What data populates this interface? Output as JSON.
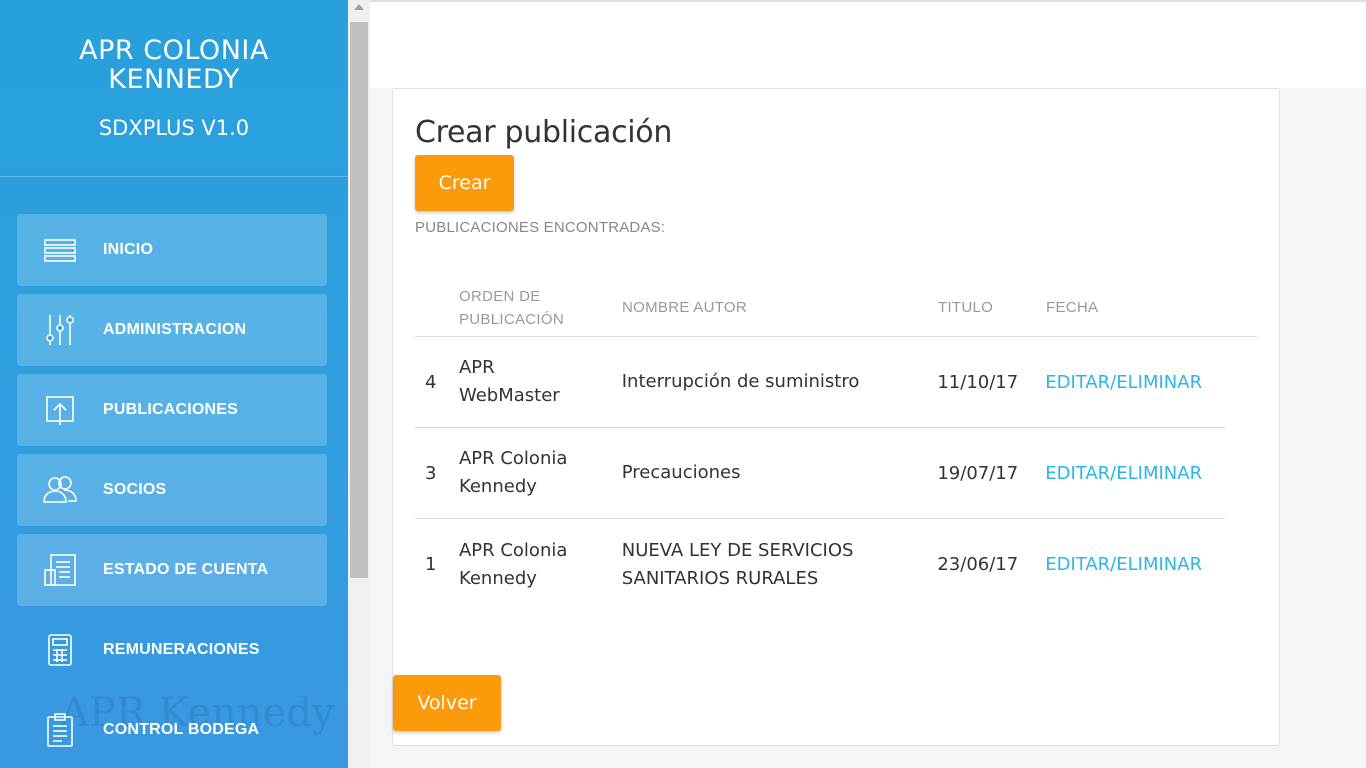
{
  "sidebar": {
    "brand_line1": "APR COLONIA",
    "brand_line2": "KENNEDY",
    "brand_sub": "SDXPLUS V1.0",
    "watermark": "APR Kennedy",
    "items": [
      {
        "label": "INICIO",
        "icon": "list-icon"
      },
      {
        "label": "ADMINISTRACION",
        "icon": "sliders-icon"
      },
      {
        "label": "PUBLICACIONES",
        "icon": "upload-icon"
      },
      {
        "label": "SOCIOS",
        "icon": "users-icon"
      },
      {
        "label": "ESTADO DE CUENTA",
        "icon": "document-icon"
      },
      {
        "label": "REMUNERACIONES",
        "icon": "calculator-icon"
      },
      {
        "label": "CONTROL BODEGA",
        "icon": "clipboard-icon"
      }
    ]
  },
  "main": {
    "title": "Crear publicación",
    "create_button": "Crear",
    "found_label": "PUBLICACIONES ENCONTRADAS:",
    "back_button": "Volver",
    "columns": {
      "orden_line1": "ORDEN DE",
      "orden_line2": "PUBLICACIÓN",
      "autor": "NOMBRE AUTOR",
      "titulo": "TITULO",
      "fecha": "FECHA"
    },
    "rows": [
      {
        "num": "4",
        "orden_line1": "APR",
        "orden_line2": "WebMaster",
        "autor_line1": "Interrupción de suministro",
        "autor_line2": "",
        "titulo": "11/10/17",
        "action": "EDITAR/ELIMINAR"
      },
      {
        "num": "3",
        "orden_line1": "APR Colonia",
        "orden_line2": "Kennedy",
        "autor_line1": "Precauciones",
        "autor_line2": "",
        "titulo": "19/07/17",
        "action": "EDITAR/ELIMINAR"
      },
      {
        "num": "1",
        "orden_line1": "APR Colonia",
        "orden_line2": "Kennedy",
        "autor_line1": "NUEVA LEY DE SERVICIOS",
        "autor_line2": "SANITARIOS RURALES",
        "titulo": "23/06/17",
        "action": "EDITAR/ELIMINAR"
      }
    ]
  },
  "colors": {
    "sidebar": "#2f9ee0",
    "accent_orange": "#fd9a0a",
    "link": "#2cb5e8"
  }
}
